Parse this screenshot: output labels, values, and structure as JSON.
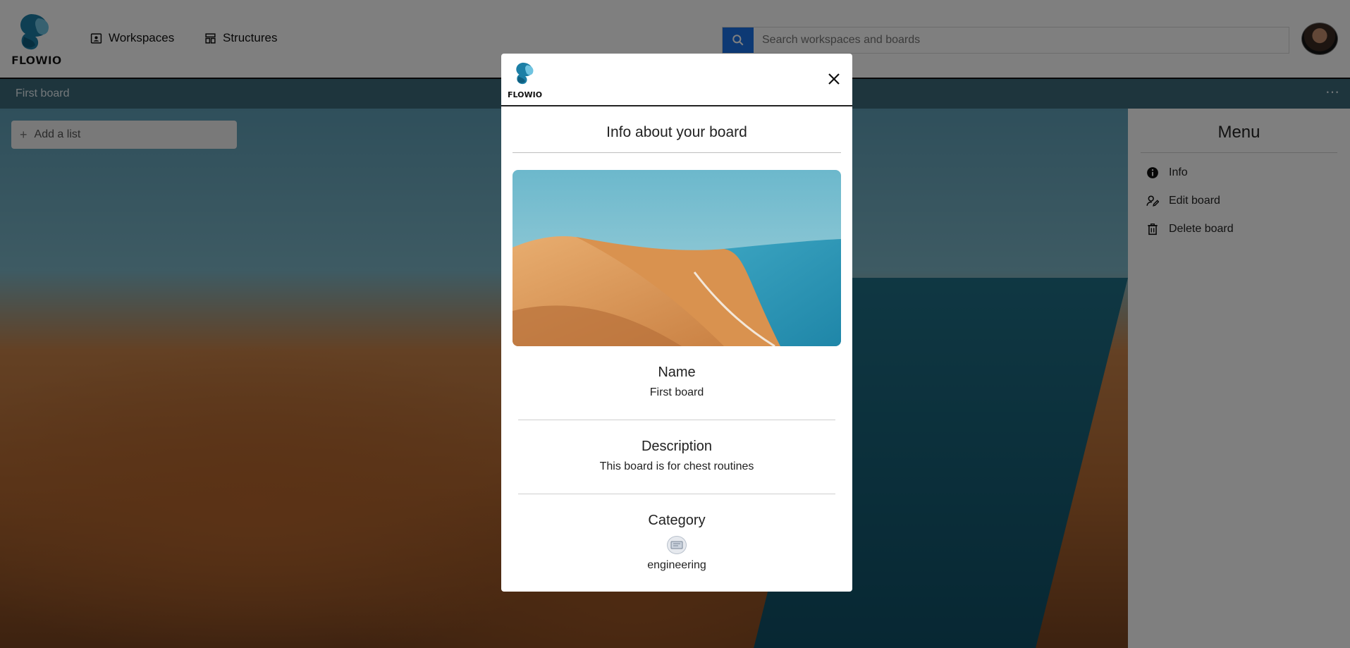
{
  "header": {
    "logo_text": "FLOWIO",
    "nav": [
      {
        "label": "Workspaces",
        "icon": "workspaces-icon"
      },
      {
        "label": "Structures",
        "icon": "structures-icon"
      }
    ],
    "search": {
      "placeholder": "Search workspaces and boards",
      "value": ""
    },
    "avatar": "user-avatar"
  },
  "board": {
    "title": "First board",
    "more_icon": "ellipsis-icon",
    "add_list_label": "Add a list"
  },
  "menu": {
    "title": "Menu",
    "items": [
      {
        "label": "Info",
        "icon": "info-icon"
      },
      {
        "label": "Edit board",
        "icon": "edit-icon"
      },
      {
        "label": "Delete board",
        "icon": "trash-icon"
      }
    ]
  },
  "modal": {
    "logo_text": "FLOWIO",
    "title": "Info about your board",
    "sections": {
      "name": {
        "label": "Name",
        "value": "First board"
      },
      "description": {
        "label": "Description",
        "value": "This board is for chest routines"
      },
      "category": {
        "label": "Category",
        "value": "engineering",
        "icon": "category-engineering-icon"
      }
    }
  },
  "colors": {
    "accent": "#1a73e8",
    "board_bar": "#3d6a7a",
    "overlay": "rgba(0,0,0,0.5)"
  }
}
